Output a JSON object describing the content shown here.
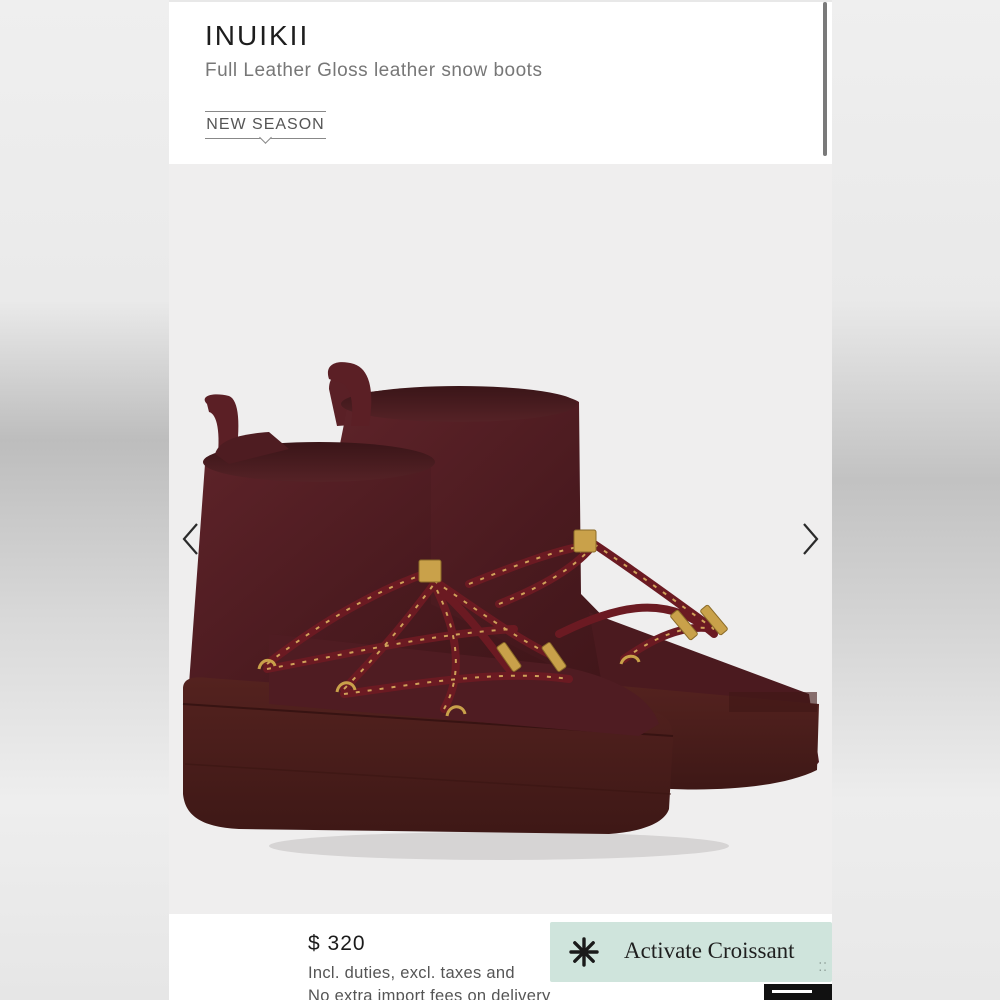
{
  "header": {
    "brand": "INUIKII",
    "subtitle": "Full Leather Gloss leather snow boots",
    "badge": "NEW SEASON"
  },
  "gallery": {
    "prev_icon": "chevron-left-icon",
    "next_icon": "chevron-right-icon",
    "image_alt": "burgundy leather lace-up snow boots"
  },
  "pricing": {
    "price": "$ 320",
    "duties_text": "Incl. duties, excl. taxes and",
    "fees_text": "No extra import fees on delivery"
  },
  "croissant": {
    "label": "Activate Croissant",
    "icon": "asterisk-icon"
  },
  "colors": {
    "leather": "#4f1a1f",
    "sole": "#4a1e1c",
    "lace": "#6b1a22",
    "metal": "#c9a14a",
    "croissant_bg": "#cfe4dc"
  }
}
